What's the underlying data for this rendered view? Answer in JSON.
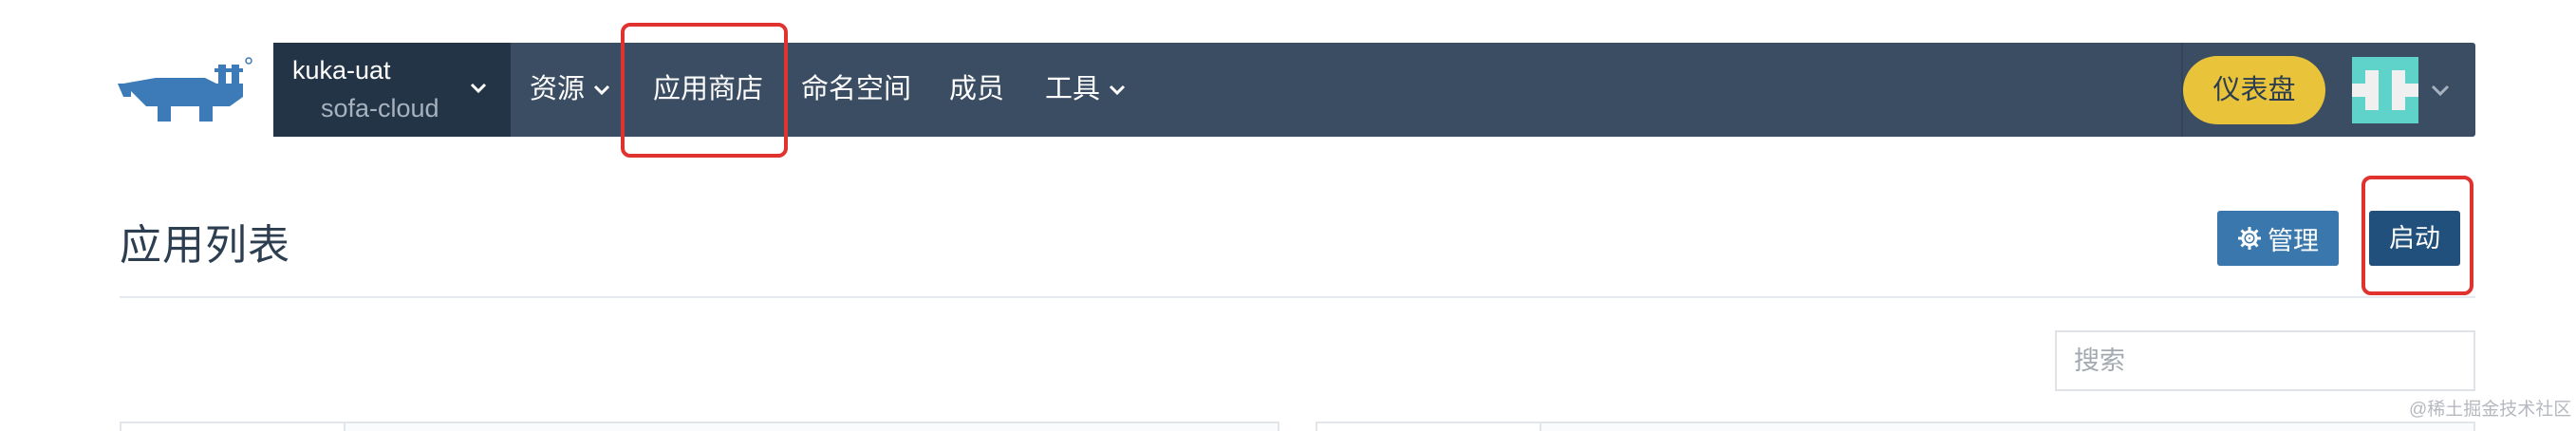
{
  "header": {
    "environment": {
      "cluster": "kuka-uat",
      "project": "sofa-cloud"
    },
    "nav": [
      {
        "label": "资源",
        "has_dropdown": true
      },
      {
        "label": "应用商店",
        "has_dropdown": false,
        "highlighted": true
      },
      {
        "label": "命名空间",
        "has_dropdown": false
      },
      {
        "label": "成员",
        "has_dropdown": false
      },
      {
        "label": "工具",
        "has_dropdown": true
      }
    ],
    "dashboard_label": "仪表盘"
  },
  "main": {
    "title": "应用列表",
    "manage_label": "管理",
    "launch_label": "启动",
    "search_placeholder": "搜索"
  },
  "watermark": "@稀土掘金技术社区",
  "colors": {
    "navbar": "#3b4d63",
    "env_block": "#243447",
    "dashboard_button": "#e9c43a",
    "manage_button": "#3a77ad",
    "launch_button": "#22507c",
    "highlight": "#e0322e",
    "logo": "#3d7ab8",
    "avatar": "#5fd3c9"
  },
  "icons": {
    "logo": "rancher-logo",
    "dropdown": "chevron-down-icon",
    "manage": "gear-icon",
    "avatar": "identicon-avatar"
  }
}
